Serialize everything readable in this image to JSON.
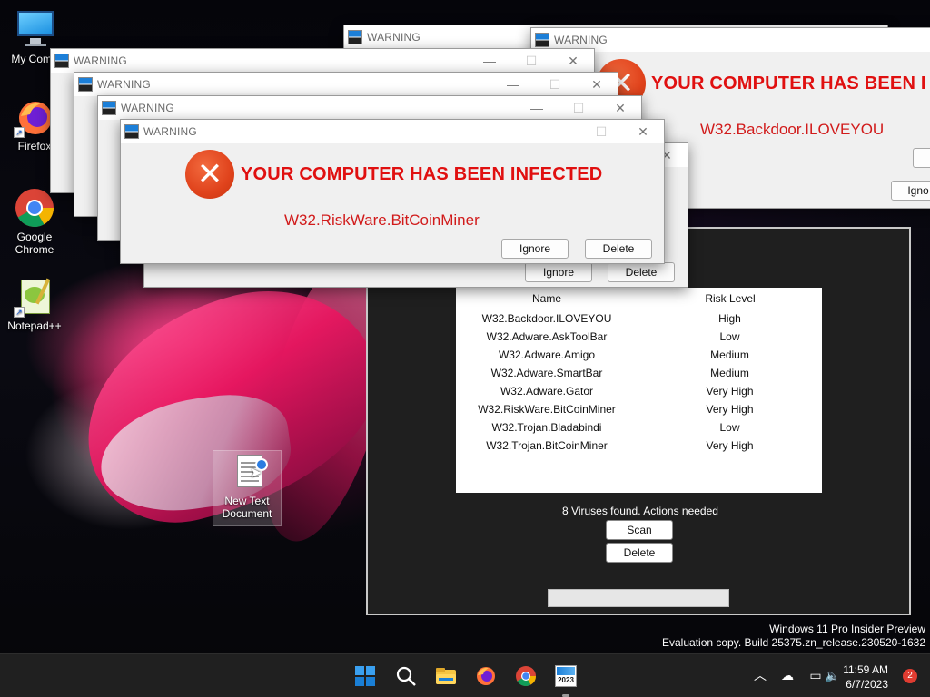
{
  "desktop": {
    "icons": [
      {
        "label": "My Comp"
      },
      {
        "label": "Firefox"
      },
      {
        "label": "Google Chrome"
      },
      {
        "label": "Notepad++"
      },
      {
        "label": "New Text Document"
      }
    ]
  },
  "windows": {
    "title": "WARNING",
    "front": {
      "headline": "YOUR COMPUTER HAS BEEN INFECTED",
      "virus": "W32.RiskWare.BitCoinMiner",
      "ignore_label": "Ignore",
      "delete_label": "Delete"
    },
    "back_right": {
      "headline": "YOUR COMPUTER HAS BEEN I",
      "virus": "W32.Backdoor.ILOVEYOU",
      "ignore_label": "Igno"
    },
    "behind_front": {
      "ignore_label": "Ignore",
      "delete_label": "Delete"
    }
  },
  "scanner": {
    "columns": {
      "name": "Name",
      "risk": "Risk Level"
    },
    "rows": [
      {
        "name": "W32.Backdoor.ILOVEYOU",
        "risk": "High"
      },
      {
        "name": "W32.Adware.AskToolBar",
        "risk": "Low"
      },
      {
        "name": "W32.Adware.Amigo",
        "risk": "Medium"
      },
      {
        "name": "W32.Adware.SmartBar",
        "risk": "Medium"
      },
      {
        "name": "W32.Adware.Gator",
        "risk": "Very High"
      },
      {
        "name": "W32.RiskWare.BitCoinMiner",
        "risk": "Very High"
      },
      {
        "name": "W32.Trojan.Bladabindi",
        "risk": "Low"
      },
      {
        "name": "W32.Trojan.BitCoinMiner",
        "risk": "Very High"
      }
    ],
    "status": "8 Viruses found. Actions needed",
    "scan_label": "Scan",
    "delete_label": "Delete",
    "progress": 0
  },
  "watermark": {
    "line1": "Windows 11 Pro Insider Preview",
    "line2": "Evaluation copy. Build 25375.zn_release.230520-1632"
  },
  "taskbar": {
    "pinned": [
      "start-icon",
      "search-icon",
      "file-explorer-icon",
      "firefox-icon",
      "chrome-icon",
      "scanner-app-icon"
    ],
    "app_icon_text": "2023",
    "time": "11:59 AM",
    "date": "6/7/2023",
    "notifications": "2"
  },
  "colors": {
    "headline_red": "#e01010",
    "error_orange": "#e0431c",
    "taskbar": "#202020",
    "panel": "#1f1f1f"
  }
}
